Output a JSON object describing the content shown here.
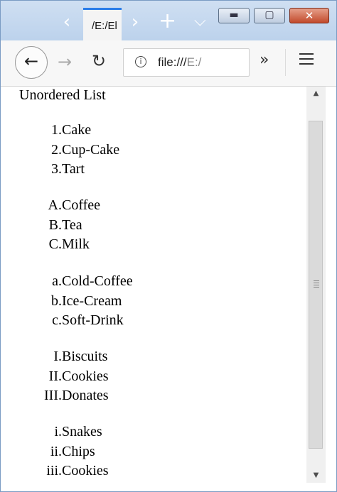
{
  "browser": {
    "tab_title": "/E:/El",
    "url_prefix": "file:///",
    "url_dim": "E:/",
    "new_tab_glyph": "+",
    "tab_list_glyph": "⌵",
    "tab_scroll_left_glyph": "‹",
    "tab_scroll_right_glyph": "›",
    "back_glyph": "←",
    "forward_glyph": "→",
    "reload_glyph": "↻",
    "overflow_glyph": "»",
    "info_glyph": "i",
    "minimize_glyph": "▬",
    "maximize_glyph": "▢",
    "close_glyph": "✕"
  },
  "page": {
    "heading": "Unordered List",
    "lists": [
      {
        "style": "decimal",
        "items": [
          {
            "marker": "1.",
            "label": "Cake"
          },
          {
            "marker": "2.",
            "label": "Cup-Cake"
          },
          {
            "marker": "3.",
            "label": "Tart"
          }
        ]
      },
      {
        "style": "upper-alpha",
        "items": [
          {
            "marker": "A.",
            "label": "Coffee"
          },
          {
            "marker": "B.",
            "label": "Tea"
          },
          {
            "marker": "C.",
            "label": "Milk"
          }
        ]
      },
      {
        "style": "lower-alpha",
        "items": [
          {
            "marker": "a.",
            "label": "Cold-Coffee"
          },
          {
            "marker": "b.",
            "label": "Ice-Cream"
          },
          {
            "marker": "c.",
            "label": "Soft-Drink"
          }
        ]
      },
      {
        "style": "upper-roman",
        "items": [
          {
            "marker": "I.",
            "label": "Biscuits"
          },
          {
            "marker": "II.",
            "label": "Cookies"
          },
          {
            "marker": "III.",
            "label": "Donates"
          }
        ]
      },
      {
        "style": "lower-roman",
        "items": [
          {
            "marker": "i.",
            "label": "Snakes"
          },
          {
            "marker": "ii.",
            "label": "Chips"
          },
          {
            "marker": "iii.",
            "label": "Cookies"
          }
        ]
      }
    ]
  },
  "scrollbar": {
    "up_glyph": "▲",
    "down_glyph": "▼"
  }
}
